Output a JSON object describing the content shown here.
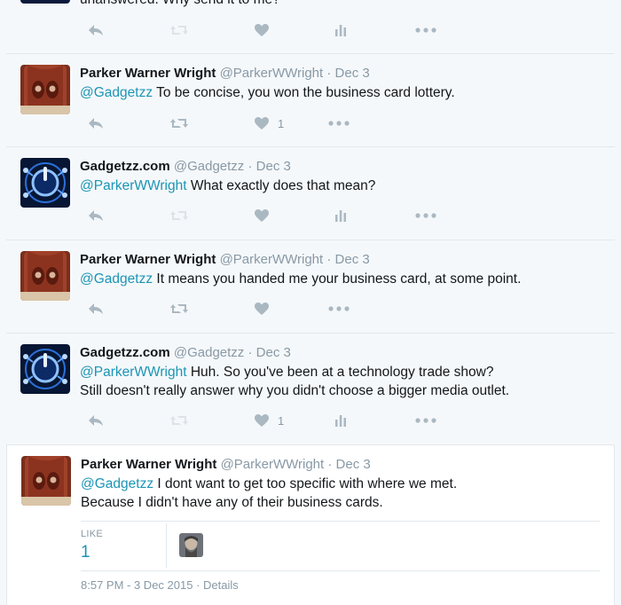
{
  "top_snippet": {
    "text": "unanswered. Why send it to me?"
  },
  "tweets": [
    {
      "name": "Parker Warner Wright",
      "handle": "@ParkerWWright",
      "date": "Dec 3",
      "mention": "@Gadgetzz",
      "body": " To be concise, you won the business card lottery.",
      "like_count": "1"
    },
    {
      "name": "Gadgetzz.com",
      "handle": "@Gadgetzz",
      "date": "Dec 3",
      "mention": "@ParkerWWright",
      "body": " What exactly does that mean?"
    },
    {
      "name": "Parker Warner Wright",
      "handle": "@ParkerWWright",
      "date": "Dec 3",
      "mention": "@Gadgetzz",
      "body": " It means you handed me your business card, at some point."
    },
    {
      "name": "Gadgetzz.com",
      "handle": "@Gadgetzz",
      "date": "Dec 3",
      "mention": "@ParkerWWright",
      "body": " Huh. So you've been at a technology trade show?",
      "body_line2": "Still doesn't really answer why you didn't choose a bigger media outlet.",
      "like_count": "1"
    },
    {
      "name": "Parker Warner Wright",
      "handle": "@ParkerWWright",
      "date": "Dec 3",
      "mention": "@Gadgetzz",
      "body": " I dont want to get too specific with where we met.",
      "body_line2": "Because I didn't have any of their business cards."
    }
  ],
  "focused": {
    "likes_label": "LIKE",
    "likes_count": "1",
    "timestamp": "8:57 PM - 3 Dec 2015 · Details"
  },
  "separator_dot": "·",
  "icons": [
    "reply-icon",
    "retweet-icon",
    "like-icon",
    "analytics-icon",
    "more-icon"
  ],
  "colors": {
    "link": "#1b95b5",
    "muted": "#8899a6",
    "icon": "#aab8c2",
    "background": "#f5f8fa"
  }
}
